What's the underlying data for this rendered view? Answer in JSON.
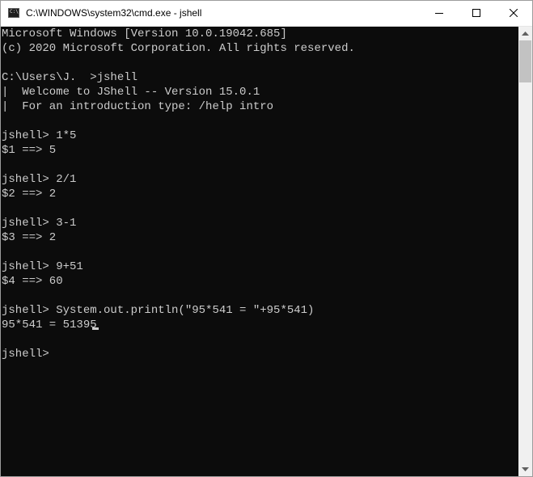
{
  "window": {
    "title": "C:\\WINDOWS\\system32\\cmd.exe - jshell",
    "app_icon": "cmd-icon",
    "controls": {
      "minimize_icon": "minimize-icon",
      "maximize_icon": "maximize-icon",
      "close_icon": "close-icon"
    }
  },
  "console": {
    "text_color": "#cccccc",
    "background": "#0c0c0c",
    "lines": [
      "Microsoft Windows [Version 10.0.19042.685]",
      "(c) 2020 Microsoft Corporation. All rights reserved.",
      "",
      "C:\\Users\\J.  >jshell",
      "|  Welcome to JShell -- Version 15.0.1",
      "|  For an introduction type: /help intro",
      "",
      "jshell> 1*5",
      "$1 ==> 5",
      "",
      "jshell> 2/1",
      "$2 ==> 2",
      "",
      "jshell> 3-1",
      "$3 ==> 2",
      "",
      "jshell> 9+51",
      "$4 ==> 60",
      "",
      "jshell> System.out.println(\"95*541 = \"+95*541)",
      "95*541 = 51395",
      "",
      "jshell> "
    ]
  },
  "scrollbar": {
    "up_icon": "scroll-up-arrow-icon",
    "down_icon": "scroll-down-arrow-icon"
  }
}
